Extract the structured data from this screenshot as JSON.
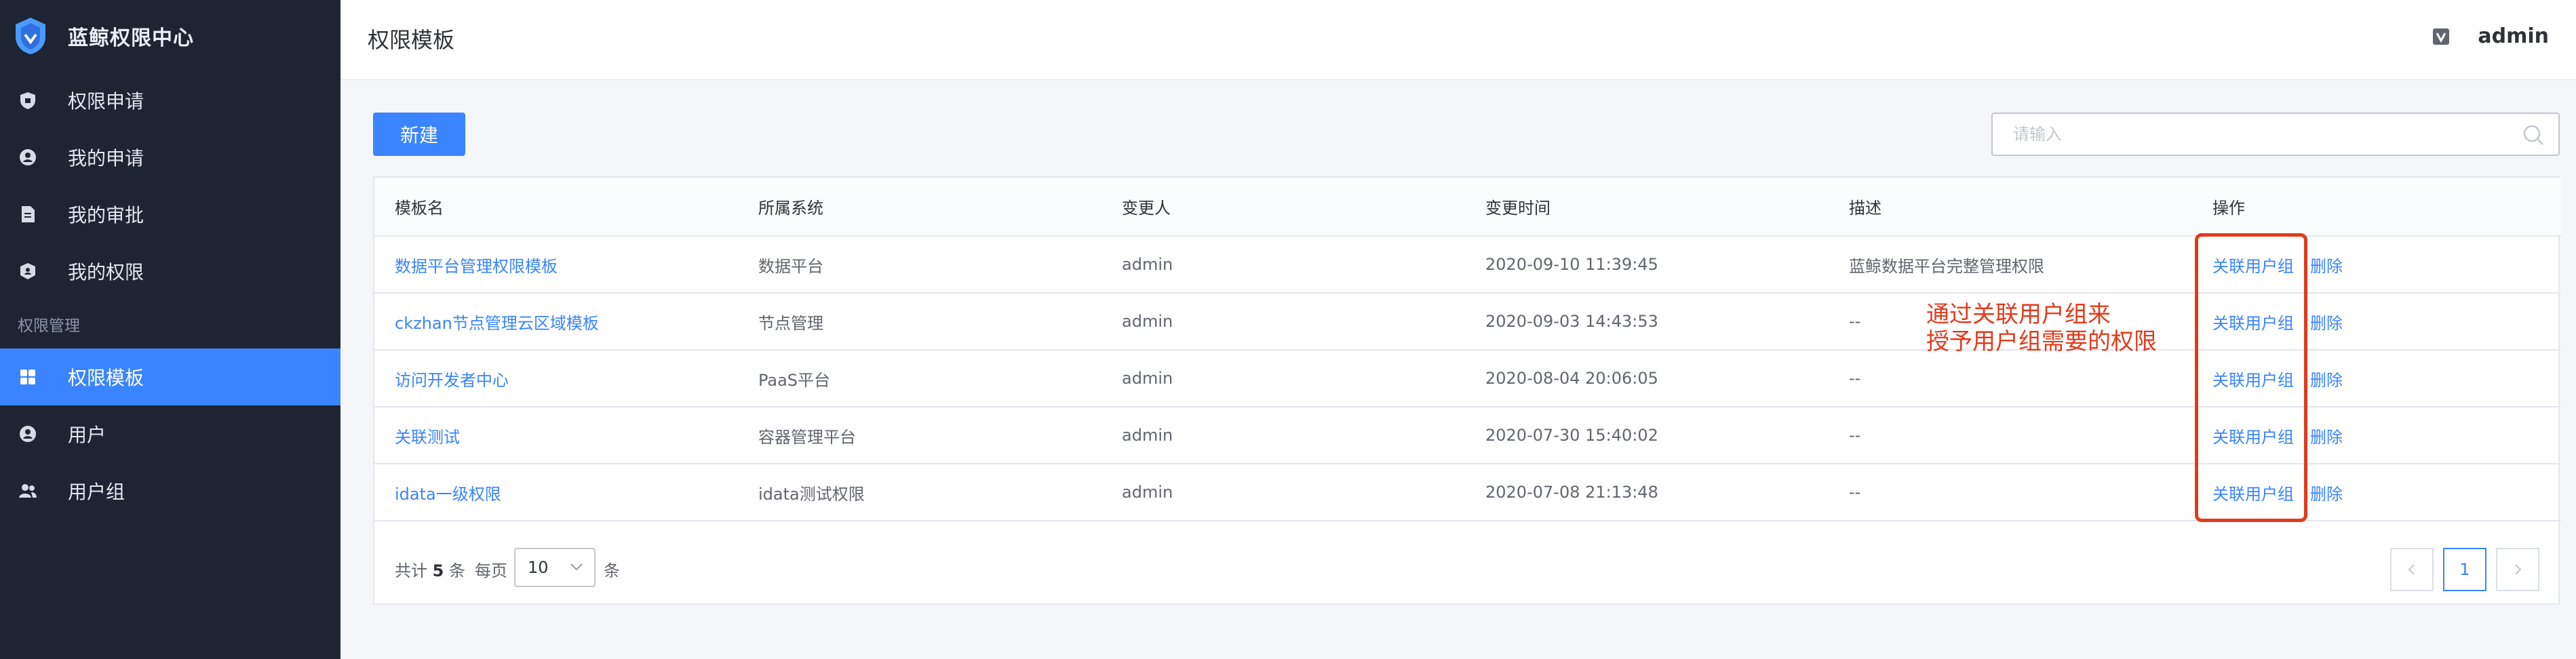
{
  "app": {
    "title": "蓝鲸权限中心"
  },
  "sidebar": {
    "items": [
      {
        "label": "权限申请",
        "icon": "permission-apply-icon"
      },
      {
        "label": "我的申请",
        "icon": "my-apply-icon"
      },
      {
        "label": "我的审批",
        "icon": "my-approval-icon"
      },
      {
        "label": "我的权限",
        "icon": "my-permission-icon"
      }
    ],
    "group_label": "权限管理",
    "manage_items": [
      {
        "label": "权限模板",
        "icon": "template-icon",
        "active": true
      },
      {
        "label": "用户",
        "icon": "user-icon"
      },
      {
        "label": "用户组",
        "icon": "user-group-icon"
      }
    ]
  },
  "header": {
    "title": "权限模板",
    "username": "admin"
  },
  "toolbar": {
    "new_label": "新建",
    "search_placeholder": "请输入"
  },
  "table": {
    "columns": [
      "模板名",
      "所属系统",
      "变更人",
      "变更时间",
      "描述",
      "操作"
    ],
    "rows": [
      {
        "name": "数据平台管理权限模板",
        "system": "数据平台",
        "updater": "admin",
        "time": "2020-09-10 11:39:45",
        "desc": "蓝鲸数据平台完整管理权限",
        "op1": "关联用户组",
        "op2": "删除"
      },
      {
        "name": "ckzhan节点管理云区域模板",
        "system": "节点管理",
        "updater": "admin",
        "time": "2020-09-03 14:43:53",
        "desc": "--",
        "op1": "关联用户组",
        "op2": "删除"
      },
      {
        "name": "访问开发者中心",
        "system": "PaaS平台",
        "updater": "admin",
        "time": "2020-08-04 20:06:05",
        "desc": "--",
        "op1": "关联用户组",
        "op2": "删除"
      },
      {
        "name": "关联测试",
        "system": "容器管理平台",
        "updater": "admin",
        "time": "2020-07-30 15:40:02",
        "desc": "--",
        "op1": "关联用户组",
        "op2": "删除"
      },
      {
        "name": "idata一级权限",
        "system": "idata测试权限",
        "updater": "admin",
        "time": "2020-07-08 21:13:48",
        "desc": "--",
        "op1": "关联用户组",
        "op2": "删除"
      }
    ]
  },
  "footer": {
    "total_prefix": "共计",
    "total_count": "5",
    "total_suffix": "条",
    "per_page_label": "每页",
    "per_page_value": "10",
    "per_page_unit": "条",
    "current_page": "1"
  },
  "annotation": {
    "line1": "通过关联用户组来",
    "line2": "授予用户组需要的权限"
  },
  "colors": {
    "primary": "#3a84ff",
    "sidebar_bg": "#1f2433",
    "annotation": "#e23a1c"
  }
}
